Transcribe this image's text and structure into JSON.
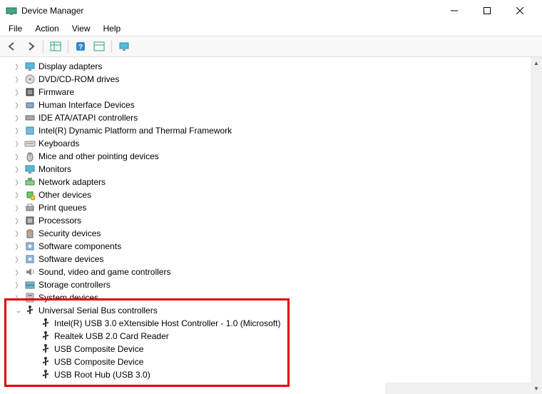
{
  "window": {
    "title": "Device Manager"
  },
  "menubar": {
    "file": "File",
    "action": "Action",
    "view": "View",
    "help": "Help"
  },
  "tree": {
    "categories": [
      {
        "label": "Display adapters",
        "icon": "monitor"
      },
      {
        "label": "DVD/CD-ROM drives",
        "icon": "disc"
      },
      {
        "label": "Firmware",
        "icon": "chip"
      },
      {
        "label": "Human Interface Devices",
        "icon": "hid"
      },
      {
        "label": "IDE ATA/ATAPI controllers",
        "icon": "controller"
      },
      {
        "label": "Intel(R) Dynamic Platform and Thermal Framework",
        "icon": "thermal"
      },
      {
        "label": "Keyboards",
        "icon": "keyboard"
      },
      {
        "label": "Mice and other pointing devices",
        "icon": "mouse"
      },
      {
        "label": "Monitors",
        "icon": "monitor"
      },
      {
        "label": "Network adapters",
        "icon": "network"
      },
      {
        "label": "Other devices",
        "icon": "other"
      },
      {
        "label": "Print queues",
        "icon": "printer"
      },
      {
        "label": "Processors",
        "icon": "cpu"
      },
      {
        "label": "Security devices",
        "icon": "security"
      },
      {
        "label": "Software components",
        "icon": "software"
      },
      {
        "label": "Software devices",
        "icon": "software"
      },
      {
        "label": "Sound, video and game controllers",
        "icon": "sound"
      },
      {
        "label": "Storage controllers",
        "icon": "storage"
      },
      {
        "label": "System devices",
        "icon": "system"
      }
    ],
    "usb": {
      "label": "Universal Serial Bus controllers",
      "children": [
        "Intel(R) USB 3.0 eXtensible Host Controller - 1.0 (Microsoft)",
        "Realtek USB 2.0 Card Reader",
        "USB Composite Device",
        "USB Composite Device",
        "USB Root Hub (USB 3.0)"
      ]
    }
  }
}
